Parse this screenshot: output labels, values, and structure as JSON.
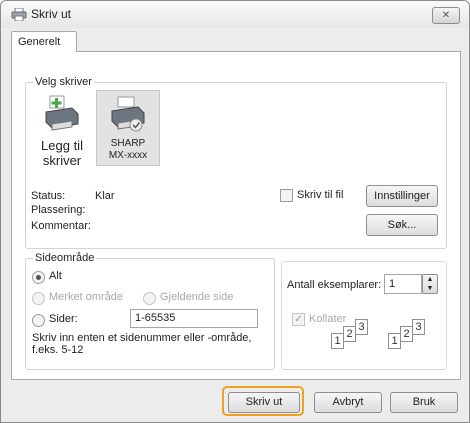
{
  "window": {
    "title": "Skriv ut",
    "close_label": "✕"
  },
  "tabs": [
    {
      "label": "Generelt"
    }
  ],
  "select_printer": {
    "label": "Velg skriver",
    "printers": [
      {
        "line1": "Legg til",
        "line2": "skriver"
      },
      {
        "line1": "SHARP",
        "line2": "MX-xxxx"
      }
    ],
    "status_label": "Status:",
    "status_value": "Klar",
    "location_label": "Plassering:",
    "comment_label": "Kommentar:",
    "print_to_file_label": "Skriv til fil",
    "preferences_button": "Innstillinger",
    "find_button": "Søk..."
  },
  "page_range": {
    "label": "Sideområde",
    "all_label": "Alt",
    "selection_label": "Merket område",
    "current_page_label": "Gjeldende side",
    "pages_label": "Sider:",
    "pages_value": "1-65535",
    "hint": "Skriv inn enten et sidenummer eller -område, f.eks. 5-12"
  },
  "copies": {
    "label": "Antall eksemplarer:",
    "value": "1",
    "collate_label": "Kollater",
    "collate_checked": true,
    "collate_pages": [
      "1",
      "2",
      "3"
    ]
  },
  "footer": {
    "print_button": "Skriv ut",
    "cancel_button": "Avbryt",
    "apply_button": "Bruk"
  },
  "colors": {
    "accent": "#f0a020",
    "panel": "#ffffff",
    "frame": "#ececec"
  }
}
